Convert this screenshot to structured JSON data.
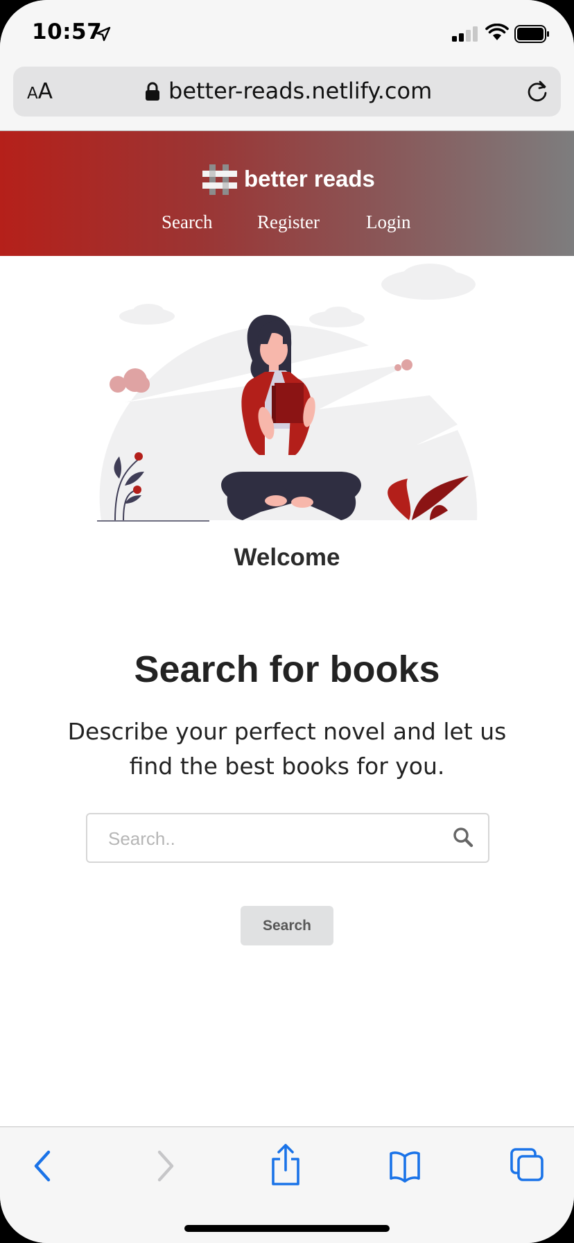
{
  "status_bar": {
    "time": "10:57",
    "location_icon": "location-arrow-icon",
    "signal_icon": "cellular-signal-icon",
    "wifi_icon": "wifi-icon",
    "battery_icon": "battery-icon"
  },
  "browser": {
    "text_size_button": {
      "small": "A",
      "large": "A"
    },
    "url": "better-reads.netlify.com",
    "lock_icon": "lock-icon",
    "reload_icon": "reload-icon"
  },
  "site_header": {
    "brand": "better reads",
    "logo_icon": "hashtag-logo-icon",
    "nav": [
      {
        "label": "Search"
      },
      {
        "label": "Register"
      },
      {
        "label": "Login"
      }
    ]
  },
  "main": {
    "illustration": "woman-reading-book-illustration",
    "welcome": "Welcome",
    "heading": "Search for books",
    "description": "Describe your perfect novel and let us find the best books for you.",
    "search": {
      "placeholder": "Search..",
      "value": "",
      "icon": "search-icon",
      "button_label": "Search"
    }
  },
  "toolbar": {
    "items": [
      "back-icon",
      "forward-icon",
      "share-icon",
      "bookmarks-icon",
      "tabs-icon"
    ]
  },
  "colors": {
    "header_gradient_start": "#b5201a",
    "header_gradient_end": "#7d7d7e",
    "accent_red": "#a8201c",
    "ios_blue": "#1a73e8",
    "button_bg": "#e0e1e2"
  }
}
